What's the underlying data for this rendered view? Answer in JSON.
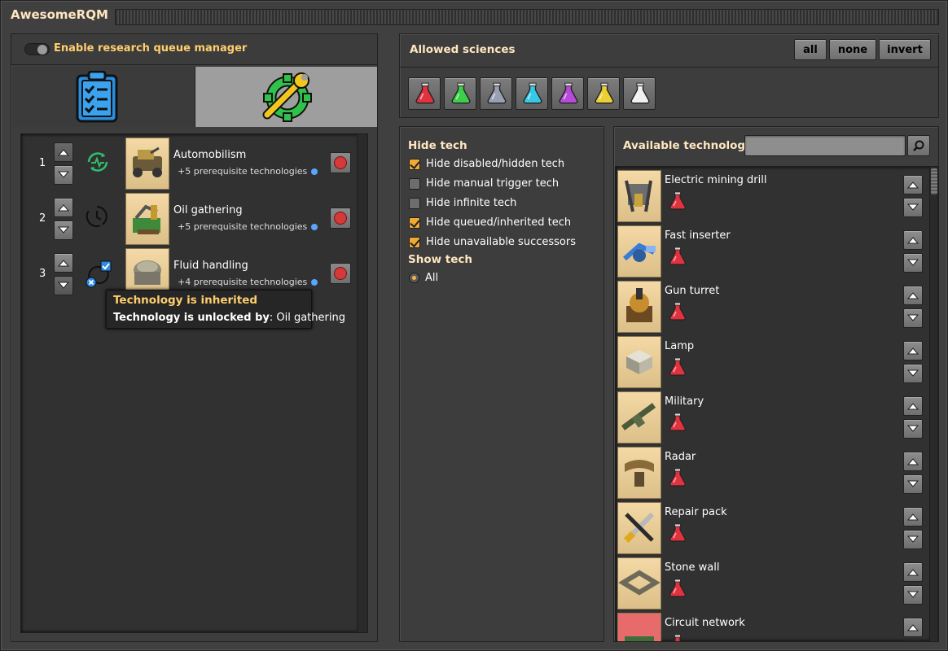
{
  "window": {
    "title": "AwesomeRQM"
  },
  "toggle": {
    "label": "Enable research queue manager",
    "state": "off"
  },
  "tabs": [
    {
      "name": "queue",
      "icon": "clipboard-checklist-icon",
      "selected": true
    },
    {
      "name": "settings",
      "icon": "wrench-gear-icon",
      "selected": false
    }
  ],
  "queue": {
    "items": [
      {
        "index": "1",
        "name": "Automobilism",
        "prereq": "+5 prerequisite technologies",
        "status_icon": "researching-pulse-icon",
        "up_enabled": false
      },
      {
        "index": "2",
        "name": "Oil gathering",
        "prereq": "+5 prerequisite technologies",
        "status_icon": "clock-icon",
        "up_enabled": true
      },
      {
        "index": "3",
        "name": "Fluid handling",
        "prereq": "+4 prerequisite technologies",
        "status_icon": "inherited-icon",
        "up_enabled": true
      }
    ],
    "tooltip": {
      "title": "Technology is inherited",
      "label": "Technology is unlocked by",
      "value": ": Oil gathering"
    }
  },
  "allowed": {
    "title": "Allowed sciences",
    "buttons": {
      "all": "all",
      "none": "none",
      "invert": "invert"
    },
    "colors": [
      "#e0333f",
      "#3dcf4a",
      "#9aa0b3",
      "#37c8e8",
      "#b54bd8",
      "#ecd033",
      "#f0f0f0"
    ]
  },
  "filters": {
    "hide_title": "Hide tech",
    "options": [
      {
        "label": "Hide disabled/hidden tech",
        "checked": true
      },
      {
        "label": "Hide manual trigger tech",
        "checked": false
      },
      {
        "label": "Hide infinite tech",
        "checked": false
      },
      {
        "label": "Hide queued/inherited tech",
        "checked": true
      },
      {
        "label": "Hide unavailable successors",
        "checked": true
      }
    ],
    "show_title": "Show tech",
    "show_option": "All"
  },
  "available": {
    "title": "Available technology",
    "search_placeholder": "",
    "items": [
      {
        "name": "Electric mining drill",
        "icon": "mining-drill-icon"
      },
      {
        "name": "Fast inserter",
        "icon": "fast-inserter-icon"
      },
      {
        "name": "Gun turret",
        "icon": "gun-turret-icon"
      },
      {
        "name": "Lamp",
        "icon": "lamp-icon"
      },
      {
        "name": "Military",
        "icon": "rifle-icon"
      },
      {
        "name": "Radar",
        "icon": "radar-icon"
      },
      {
        "name": "Repair pack",
        "icon": "repair-pack-icon"
      },
      {
        "name": "Stone wall",
        "icon": "stone-wall-icon"
      },
      {
        "name": "Circuit network",
        "icon": "circuit-network-icon"
      }
    ]
  }
}
